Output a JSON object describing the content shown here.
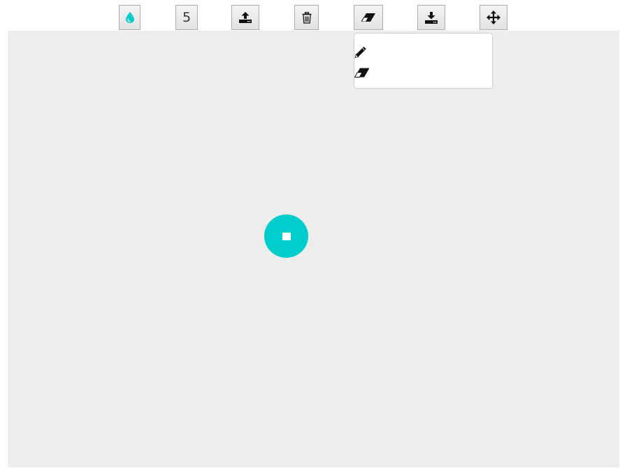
{
  "toolbar": {
    "color_icon": "water-drop-icon",
    "brush_size": "5",
    "upload_icon": "upload-icon",
    "trash_icon": "trash-icon",
    "tool_icon": "eraser-icon",
    "download_icon": "download-icon",
    "move_icon": "move-arrows-icon"
  },
  "tool_menu": {
    "items": [
      {
        "icon": "pencil-icon",
        "label": ""
      },
      {
        "icon": "eraser-icon",
        "label": ""
      }
    ]
  },
  "colors": {
    "brush": "#00cccc",
    "canvas_background": "#ededed"
  }
}
